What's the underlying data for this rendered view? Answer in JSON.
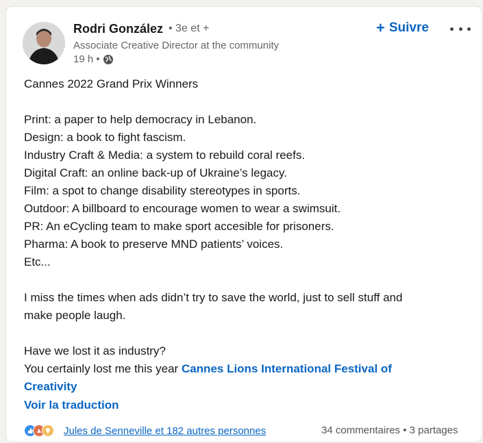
{
  "post": {
    "author": {
      "name": "Rodri González",
      "degree": "• 3e et +",
      "headline": "Associate Creative Director at the community",
      "time": "19 h •",
      "visibility_icon": "globe-icon"
    },
    "follow_label": "Suivre",
    "follow_prefix": "+",
    "colors": {
      "accent": "#0a66c2",
      "text": "#191919",
      "muted": "#666666"
    },
    "lines_1": [
      "Cannes 2022 Grand Prix Winners"
    ],
    "lines_2": [
      "Print: a paper to help democracy in Lebanon.",
      "Design: a book to fight fascism.",
      "Industry Craft & Media: a system to rebuild coral reefs.",
      "Digital Craft: an online back-up of Ukraine’s legacy.",
      "Film: a spot to change disability stereotypes in sports.",
      "Outdoor: A billboard to encourage women to wear a swimsuit.",
      "PR: An eCycling team to make sport accesible for prisoners.",
      "Pharma: A book to preserve MND patients’ voices.",
      "Etc..."
    ],
    "para_3_line_1": "I miss the times when ads didn’t try to save the world, just to sell stuff and",
    "para_3_line_2": "make people laugh.",
    "para_4_line_1": "Have we lost it as industry?",
    "para_4_line_2_text": "You certainly lost me this year ",
    "para_4_mention_a": "Cannes Lions International Festival of",
    "para_4_mention_b": "Creativity",
    "translate_label": "Voir la traduction",
    "reactions": {
      "icons": [
        "like-icon",
        "celebrate-icon",
        "insightful-icon"
      ],
      "likers": "Jules de Senneville et 182 autres personnes"
    },
    "comments": "34 commentaires",
    "separator": "•",
    "shares": "3 partages"
  }
}
